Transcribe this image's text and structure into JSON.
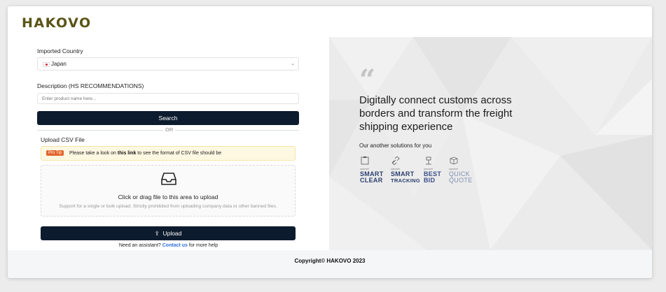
{
  "brand": {
    "logo": "HAKOVO"
  },
  "form": {
    "country_label": "Imported Country",
    "country_value": "Japan",
    "description_label": "Description (HS RECOMMENDATIONS)",
    "description_placeholder": "Enter product name here...",
    "search_label": "Search",
    "or_label": "OR",
    "upload_section_label": "Upload CSV File",
    "protip": {
      "tag": "Pro Tip",
      "text_before": "Please take a look on",
      "link": "this link",
      "text_after": "to see the format of CSV file should be"
    },
    "dropzone": {
      "title": "Click or drag file to this area to upload",
      "hint": "Support for a single or bulk upload. Strictly prohibited from uploading company data or other banned files."
    },
    "upload_label": "Upload",
    "assist": {
      "before": "Need an assistant?",
      "link": "Contact us",
      "after": "for more help"
    }
  },
  "hero": {
    "headline": "Digitally connect customs across borders and transform the freight shipping experience",
    "solutions_label": "Our another solutions for you",
    "products": [
      {
        "small": "HAKOVO®",
        "line1": "SMART",
        "line2": "CLEAR",
        "icon": "clipboard-icon"
      },
      {
        "small": "HAKOVO®",
        "line1": "SMART",
        "line2": "TRACKING",
        "icon": "link-chain-icon"
      },
      {
        "small": "HAKOVO®",
        "line1": "BEST",
        "line2": "BID",
        "icon": "auction-icon"
      },
      {
        "small": "HAKOVO®",
        "line1": "QUICK",
        "line2": "QUOTE",
        "icon": "box-icon"
      }
    ]
  },
  "footer": {
    "copyright": "Copyright© HAKOVO 2023"
  },
  "colors": {
    "primary_dark": "#0d1b2e",
    "logo": "#5a5418",
    "pro_tip": "#e3652a",
    "link": "#2f6fe0",
    "quick_quote": "#7e8fb1",
    "best_bid": "#3a4f8a"
  }
}
